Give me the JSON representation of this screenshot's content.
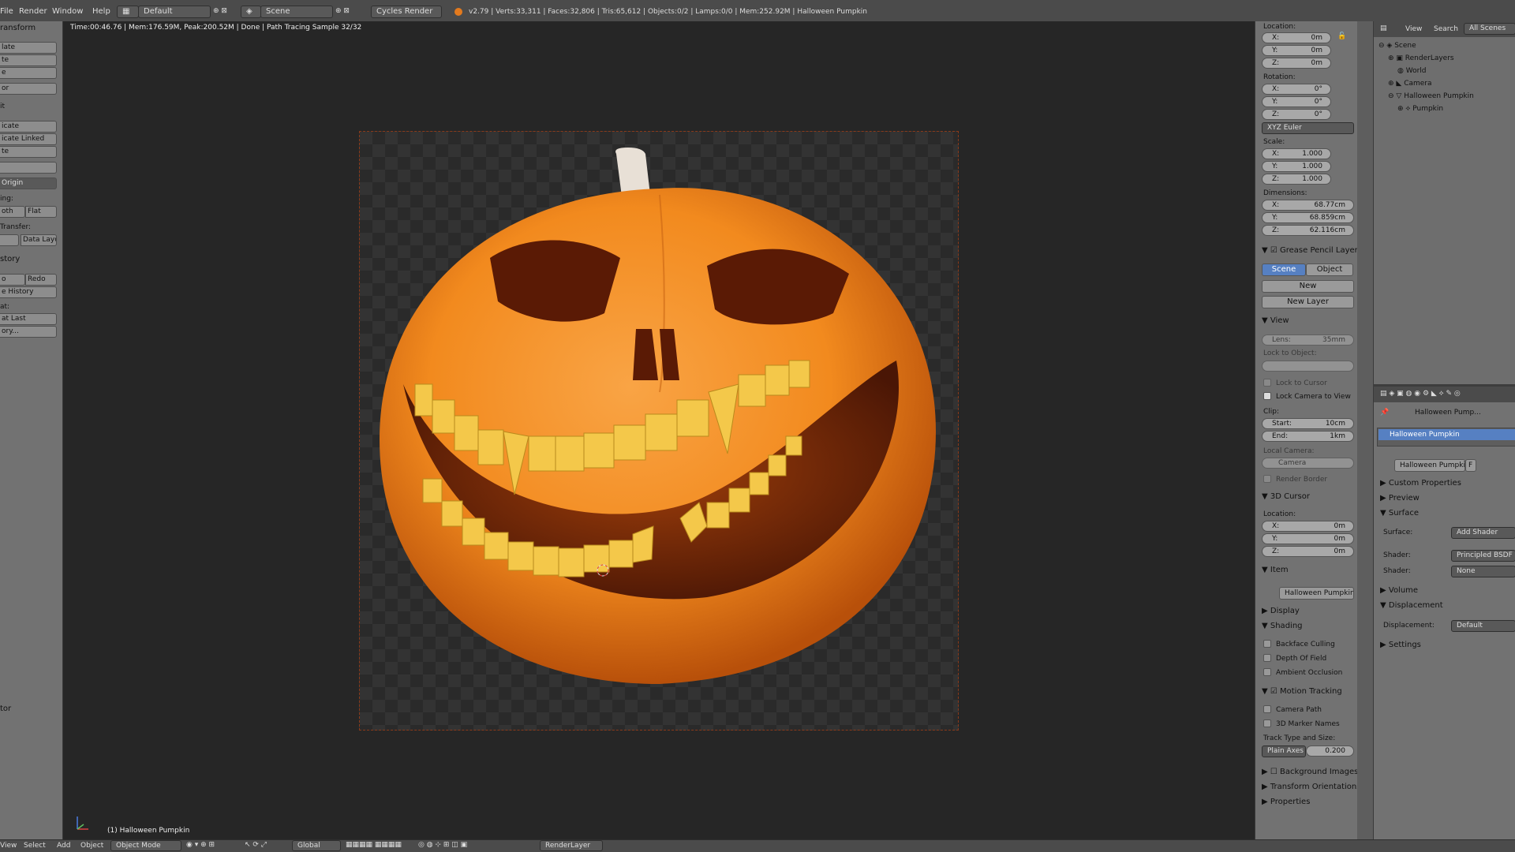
{
  "colors": {
    "accent": "#5680c2",
    "pumpkin": "#f28a1e",
    "pumpkin_dark": "#c0520a",
    "teeth": "#f4c84a"
  },
  "top_menu": {
    "items": [
      "File",
      "Render",
      "Window",
      "Help"
    ],
    "layout": "Default",
    "scene": "Scene",
    "engine": "Cycles Render",
    "stats": "v2.79 | Verts:33,311 | Faces:32,806 | Tris:65,612 | Objects:0/2 | Lamps:0/0 | Mem:252.92M | Halloween Pumpkin"
  },
  "viewport": {
    "status": "Time:00:46.76 | Mem:176.59M, Peak:200.52M | Done | Path Tracing Sample 32/32",
    "object_label": "(1) Halloween Pumpkin"
  },
  "left_panel": {
    "transform_header": "ransform",
    "buttons": [
      "late",
      "te",
      "e",
      "or"
    ],
    "edit_header": "it",
    "edit_buttons": [
      "icate",
      "icate Linked",
      "te"
    ],
    "origin": "Origin",
    "shading_label": "ing:",
    "smooth": "oth",
    "flat": "Flat",
    "transfer_label": "Transfer:",
    "data_layo": "Data Layo",
    "history_header": "story",
    "undo": "o",
    "redo": "Redo",
    "undo_history": "e History",
    "repeat_label": "at:",
    "repeat_last": "at Last",
    "repeat_history": "ory...",
    "bottom_label": "tor"
  },
  "n_panel": {
    "location_label": "Location:",
    "loc": {
      "x": "0m",
      "y": "0m",
      "z": "0m"
    },
    "rotation_label": "Rotation:",
    "rot": {
      "x": "0°",
      "y": "0°",
      "z": "0°"
    },
    "euler": "XYZ Euler",
    "scale_label": "Scale:",
    "scale": {
      "x": "1.000",
      "y": "1.000",
      "z": "1.000"
    },
    "dimensions_label": "Dimensions:",
    "dim": {
      "x": "68.77cm",
      "y": "68.859cm",
      "z": "62.116cm"
    },
    "grease_pencil": "Grease Pencil Layers",
    "gp_scene": "Scene",
    "gp_object": "Object",
    "gp_new": "New",
    "gp_new_layer": "New Layer",
    "view_header": "View",
    "lens": "Lens:",
    "lens_val": "35mm",
    "lock_to_object": "Lock to Object:",
    "lock_to_cursor": "Lock to Cursor",
    "lock_camera": "Lock Camera to View",
    "clip_label": "Clip:",
    "clip_start": "Start:",
    "clip_start_val": "10cm",
    "clip_end": "End:",
    "clip_end_val": "1km",
    "local_camera": "Local Camera:",
    "camera": "Camera",
    "render_border": "Render Border",
    "cursor_header": "3D Cursor",
    "cursor_location": "Location:",
    "cur": {
      "x": "0m",
      "y": "0m",
      "z": "0m"
    },
    "item_header": "Item",
    "item_name": "Halloween Pumpkin",
    "display_header": "Display",
    "shading_header": "Shading",
    "backface": "Backface Culling",
    "dof": "Depth Of Field",
    "ao": "Ambient Occlusion",
    "motion_tracking": "Motion Tracking",
    "camera_path": "Camera Path",
    "marker_names": "3D Marker Names",
    "track_type": "Track Type and Size:",
    "plain_axes": "Plain Axes",
    "track_size": "0.200",
    "bg_images": "Background Images",
    "transform_orient": "Transform Orientations",
    "properties": "Properties",
    "axis_x": "X:",
    "axis_y": "Y:",
    "axis_z": "Z:"
  },
  "outliner": {
    "view": "View",
    "search": "Search",
    "all_scenes": "All Scenes",
    "items": [
      "Scene",
      "RenderLayers",
      "World",
      "Camera",
      "Halloween Pumpkin",
      "Pumpkin"
    ]
  },
  "properties": {
    "breadcrumb": "Halloween Pump...",
    "material_slot": "Halloween Pumpkin",
    "material_name": "Halloween Pumpkin",
    "f_label": "F",
    "custom_props": "Custom Properties",
    "preview": "Preview",
    "surface_header": "Surface",
    "surface_label": "Surface:",
    "surface_val": "Add Shader",
    "shader_label": "Shader:",
    "shader_val": "Principled BSDF",
    "shader2_label": "Shader:",
    "shader2_val": "None",
    "volume": "Volume",
    "displacement_header": "Displacement",
    "displacement_label": "Displacement:",
    "displacement_val": "Default",
    "settings": "Settings"
  },
  "bottom_bar": {
    "view": "View",
    "select": "Select",
    "add": "Add",
    "object": "Object",
    "mode": "Object Mode",
    "orientation": "Global",
    "render_layer": "RenderLayer"
  }
}
